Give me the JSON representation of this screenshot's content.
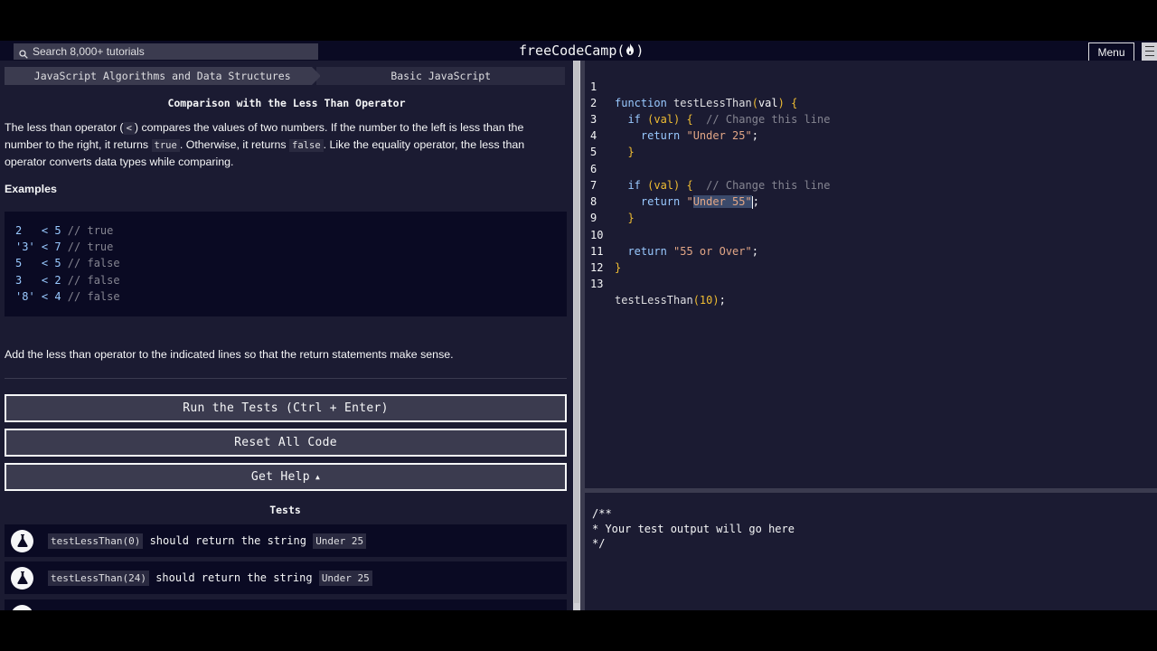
{
  "navbar": {
    "search_placeholder": "Search 8,000+ tutorials",
    "brand_left": "freeCodeCamp(",
    "brand_icon": "flame-icon",
    "brand_right": ")",
    "menu_label": "Menu"
  },
  "breadcrumb": {
    "superblock": "JavaScript Algorithms and Data Structures",
    "block": "Basic JavaScript"
  },
  "challenge": {
    "title": "Comparison with the Less Than Operator",
    "desc_1": "The less than operator (",
    "desc_code_1": "<",
    "desc_2": ") compares the values of two numbers. If the number to the left is less than the number to the right, it returns ",
    "desc_code_2": "true",
    "desc_3": ". Otherwise, it returns ",
    "desc_code_3": "false",
    "desc_4": ". Like the equality operator, the less than operator converts data types while comparing.",
    "examples_label": "Examples",
    "examples": [
      {
        "code": "2   < 5 ",
        "comment": "// true"
      },
      {
        "code": "'3' < 7 ",
        "comment": "// true"
      },
      {
        "code": "5   < 5 ",
        "comment": "// false"
      },
      {
        "code": "3   < 2 ",
        "comment": "// false"
      },
      {
        "code": "'8' < 4 ",
        "comment": "// false"
      }
    ],
    "instruction": "Add the less than operator to the indicated lines so that the return statements make sense."
  },
  "buttons": {
    "run": "Run the Tests (Ctrl + Enter)",
    "reset": "Reset All Code",
    "help": "Get Help",
    "help_caret": "▲"
  },
  "tests": {
    "heading": "Tests",
    "items": [
      {
        "call": "testLessThan(0)",
        "text": " should return the string ",
        "value": "Under 25"
      },
      {
        "call": "testLessThan(24)",
        "text": " should return the string ",
        "value": "Under 25"
      }
    ]
  },
  "editor": {
    "line_numbers": [
      "1",
      "2",
      "3",
      "4",
      "5",
      "6",
      "7",
      "8",
      "9",
      "10",
      "11",
      "12",
      "13"
    ],
    "lines": {
      "l1_kw": "function",
      "l1_name": " testLessThan",
      "l1_open": "(",
      "l1_param": "val",
      "l1_close": ")",
      "l1_brace": " {",
      "l2_kw": "  if",
      "l2_cond": " (val)",
      "l2_brace": " {",
      "l2_cmt": "  // Change this line",
      "l3_kw": "    return",
      "l3_str": " \"Under 25\"",
      "l3_end": ";",
      "l4": "  }",
      "l6_kw": "  if",
      "l6_cond": " (val)",
      "l6_brace": " {",
      "l6_cmt": "  // Change this line",
      "l7_kw": "    return",
      "l7_q1": " \"",
      "l7_sel": "Under 55",
      "l7_q2": "\"",
      "l7_end": ";",
      "l8": "  }",
      "l10_kw": "  return",
      "l10_str": " \"55 or Over\"",
      "l10_end": ";",
      "l11": "}",
      "l13_call": "testLessThan",
      "l13_args": "(10)",
      "l13_end": ";"
    }
  },
  "console": {
    "lines": [
      "/**",
      "* Your test output will go here",
      "*/"
    ]
  },
  "colors": {
    "background": "#1b1b32",
    "dark": "#0a0a23",
    "button": "#3b3b4f",
    "keyword": "#99c9ff",
    "string": "#e2a686",
    "bracket": "#f1be32",
    "comment": "#858591"
  }
}
